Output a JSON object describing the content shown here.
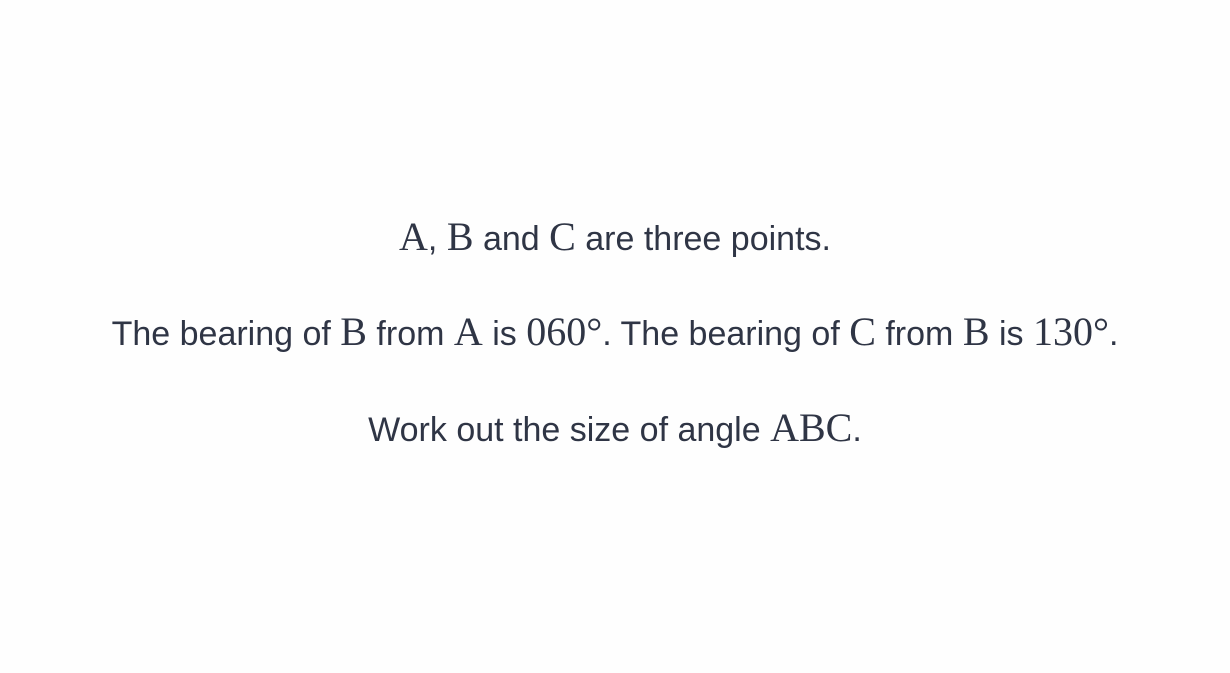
{
  "question": {
    "line1": {
      "a": "A",
      "comma": ", ",
      "b": "B",
      "and": " and ",
      "c": "C",
      "rest": " are three points."
    },
    "line2": {
      "t1": "The bearing of ",
      "b1": "B",
      "t2": " from ",
      "a1": "A",
      "t3": " is ",
      "angle1": "060°",
      "t4": ". The bearing of ",
      "c1": "C",
      "t5": " from ",
      "b2": "B",
      "t6": " is ",
      "angle2": "130°",
      "t7": "."
    },
    "line3": {
      "t1": "Work out the size of angle ",
      "angle_name": "ABC",
      "t2": "."
    }
  }
}
